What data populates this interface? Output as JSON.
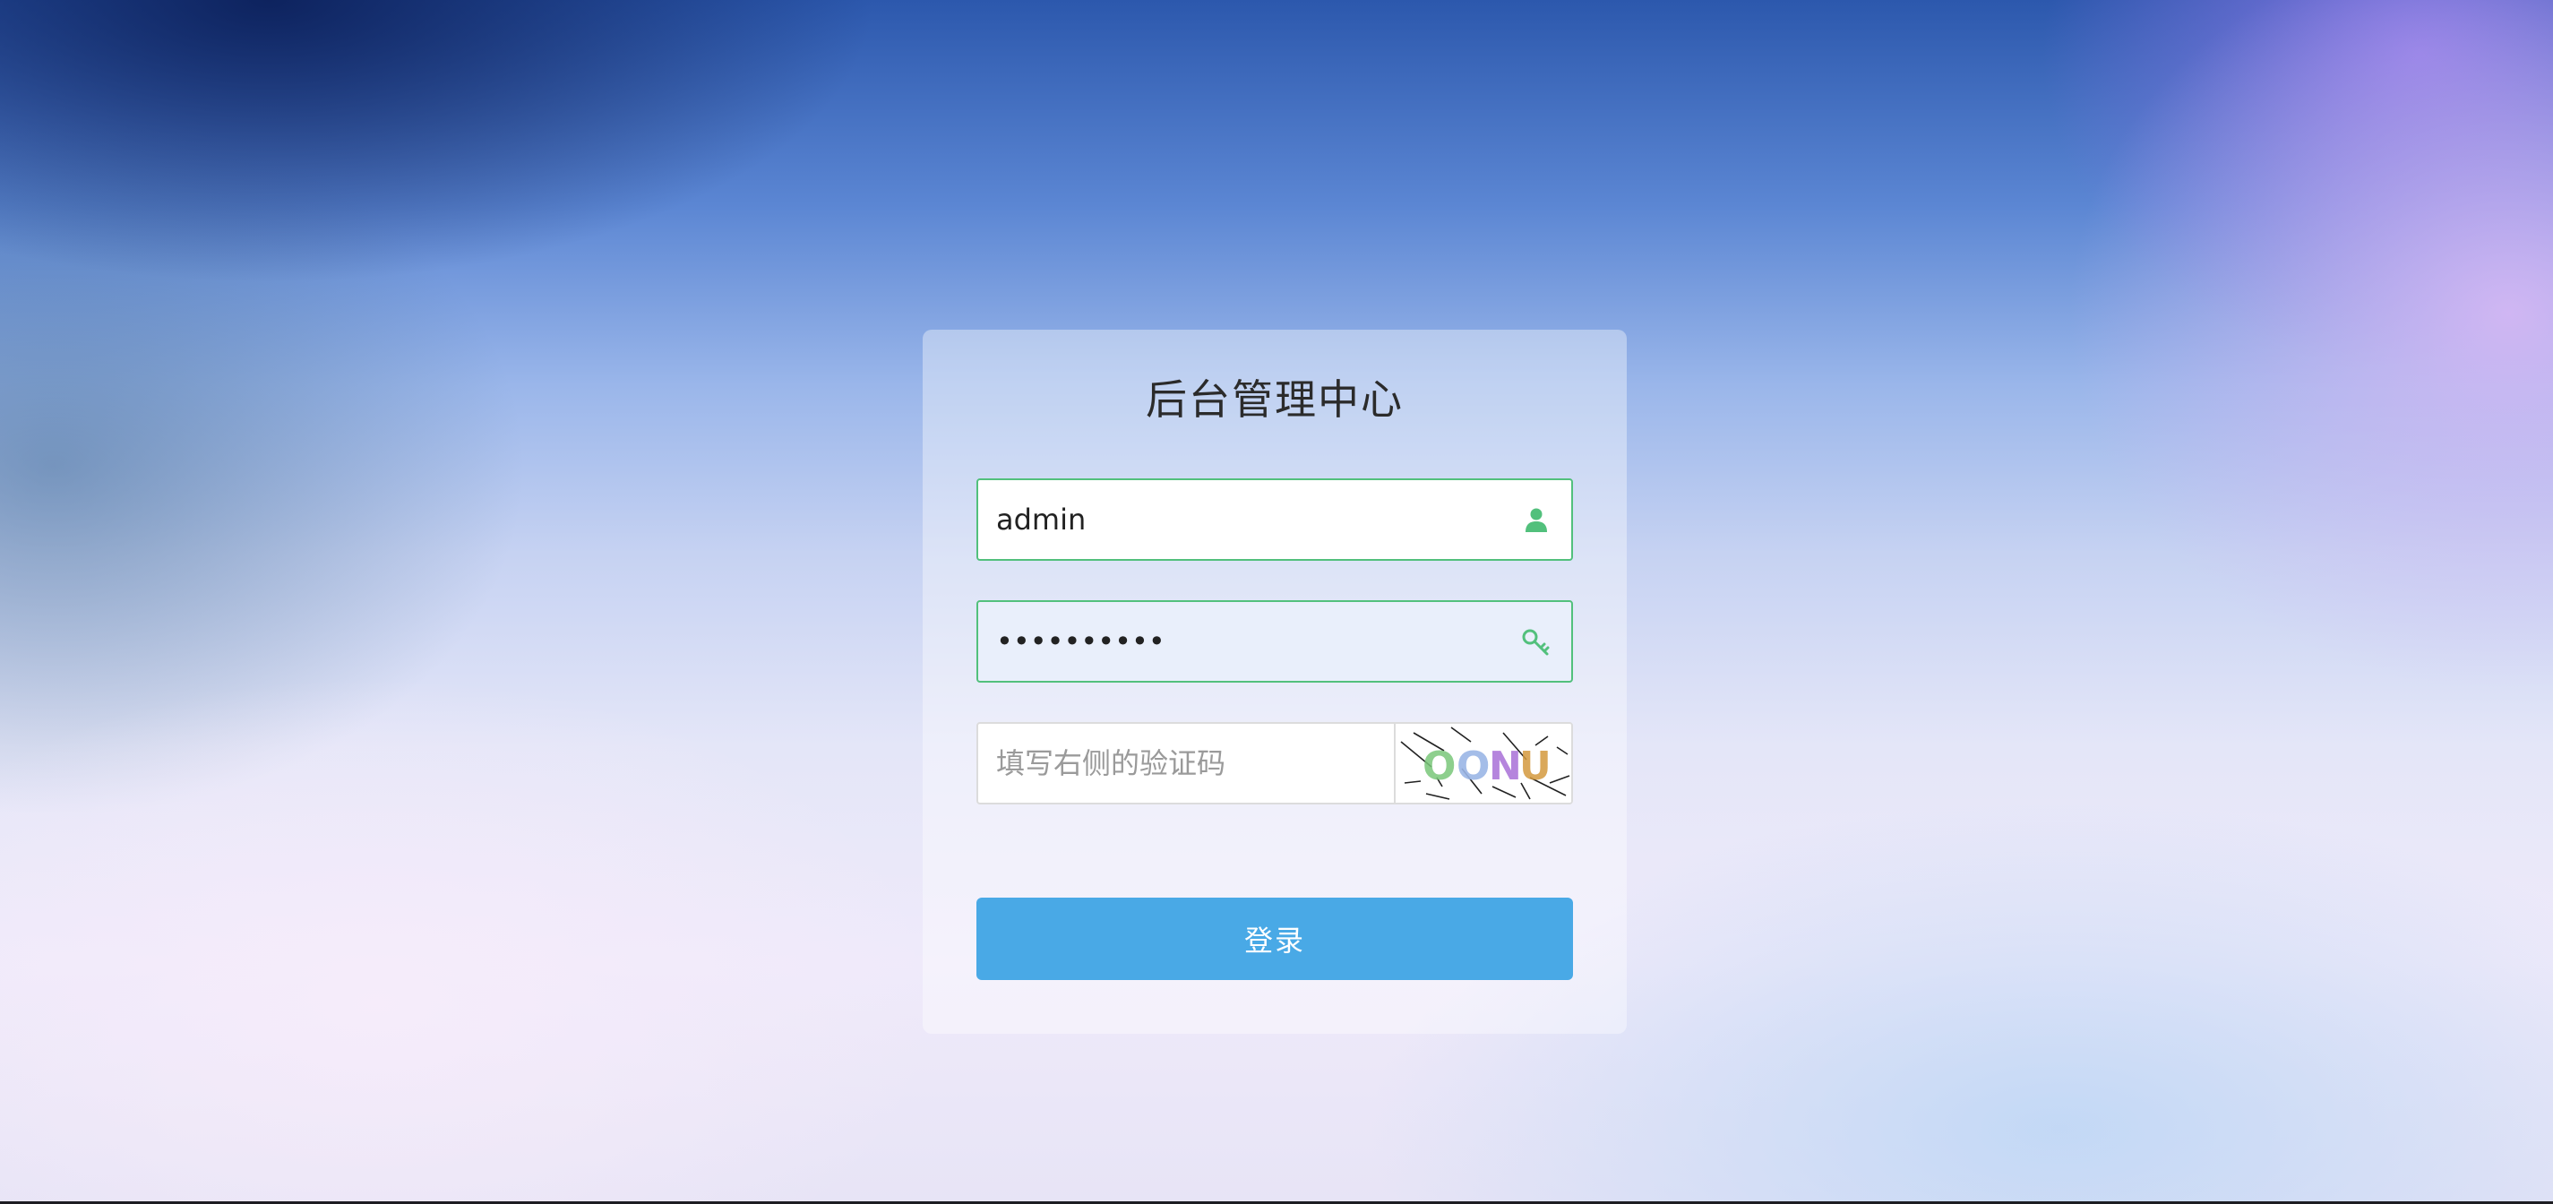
{
  "login": {
    "title": "后台管理中心",
    "username": {
      "value": "admin",
      "icon": "user-icon"
    },
    "password": {
      "value": "1234567890",
      "icon": "key-icon"
    },
    "captcha": {
      "placeholder": "填写右侧的验证码",
      "value": "",
      "code_text": "OONU",
      "icon": "captcha-image"
    },
    "submit_label": "登录"
  },
  "colors": {
    "field_border_valid": "#52c07c",
    "icon_green": "#52c07c",
    "button_bg": "#49a9e6",
    "button_text": "#ffffff",
    "title_text": "#2b2b2b"
  }
}
